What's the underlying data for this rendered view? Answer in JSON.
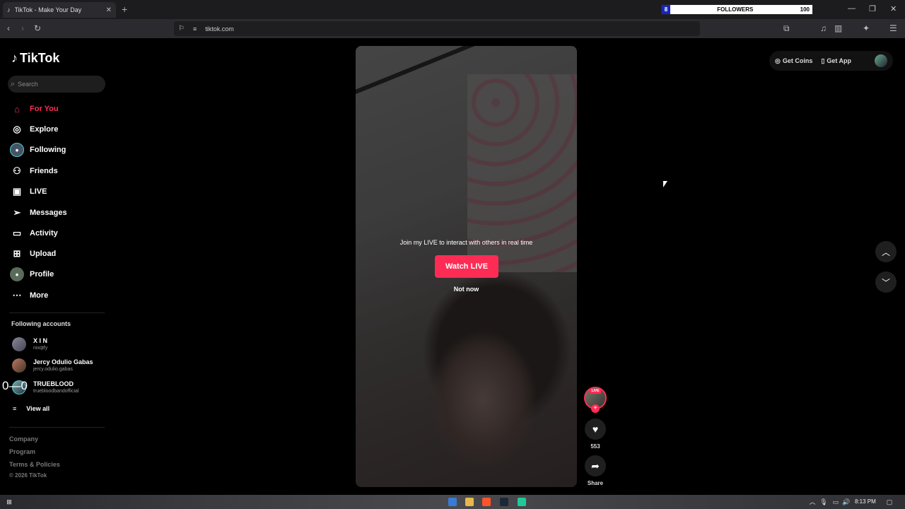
{
  "browser": {
    "tab_title": "TikTok - Make Your Day",
    "url": "tiktok.com",
    "followers_widget": {
      "count": "8",
      "label": "FOLLOWERS",
      "goal": "100"
    }
  },
  "sidebar": {
    "logo": "TikTok",
    "search_placeholder": "Search",
    "nav": [
      {
        "label": "For You",
        "icon": "home-icon"
      },
      {
        "label": "Explore",
        "icon": "compass-icon"
      },
      {
        "label": "Following",
        "icon": "avatar-icon"
      },
      {
        "label": "Friends",
        "icon": "friends-icon"
      },
      {
        "label": "LIVE",
        "icon": "live-icon"
      },
      {
        "label": "Messages",
        "icon": "send-icon"
      },
      {
        "label": "Activity",
        "icon": "activity-icon"
      },
      {
        "label": "Upload",
        "icon": "plus-square-icon"
      },
      {
        "label": "Profile",
        "icon": "profile-avatar-icon"
      },
      {
        "label": "More",
        "icon": "more-dots-icon"
      }
    ],
    "following_title": "Following accounts",
    "accounts": [
      {
        "name": "X I N",
        "handle": "nixqtfy"
      },
      {
        "name": "Jercy Odulio Gabas",
        "handle": "jercy.odulio.gabas"
      },
      {
        "name": "TRUEBLOOD",
        "handle": "truebloodbandofficial"
      }
    ],
    "view_all": "View all",
    "footer": [
      "Company",
      "Program",
      "Terms & Policies",
      "© 2026 TikTok"
    ]
  },
  "overlay_stray_text": "0—0",
  "video": {
    "prompt": "Join my LIVE to interact with others in real time",
    "watch_live": "Watch LIVE",
    "not_now": "Not now",
    "live_badge": "LIVE",
    "likes": "553",
    "share_label": "Share"
  },
  "header": {
    "get_coins": "Get Coins",
    "get_app": "Get App"
  },
  "taskbar": {
    "time": "8:13 PM"
  },
  "colors": {
    "accent": "#fe2c55",
    "bg": "#000000"
  }
}
